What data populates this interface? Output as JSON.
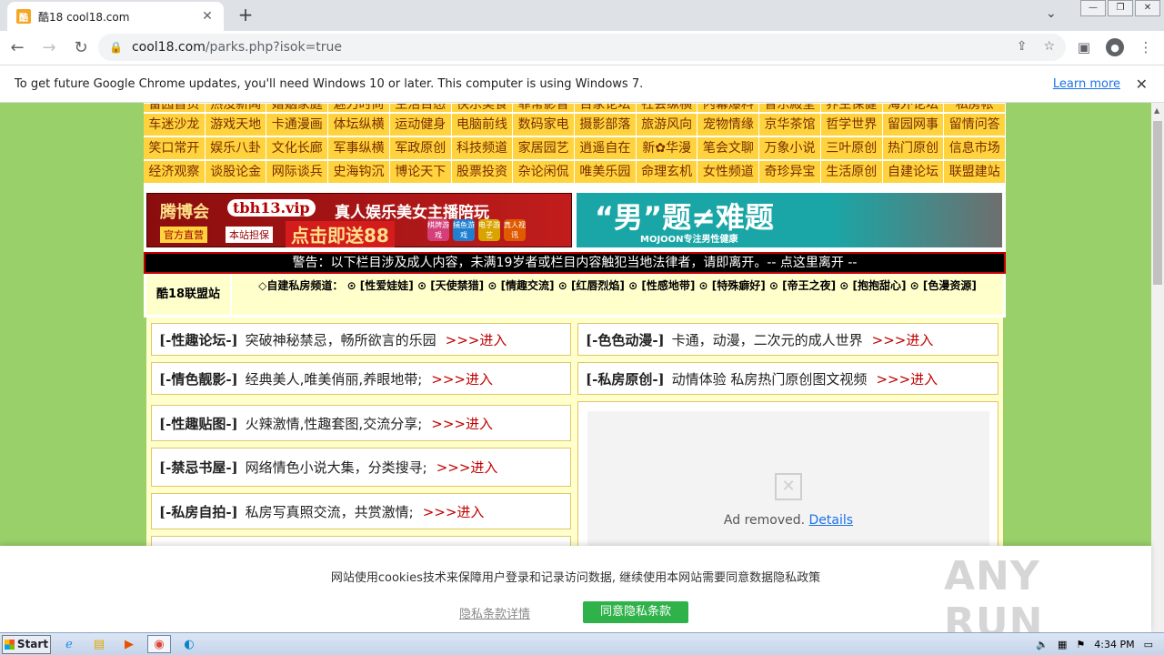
{
  "browser": {
    "tab_title": "酷18 cool18.com",
    "favicon_text": "酷",
    "url_host": "cool18.com",
    "url_path": "/parks.php?isok=true"
  },
  "infobar": {
    "message": "To get future Google Chrome updates, you'll need Windows 10 or later. This computer is using Windows 7.",
    "learn_more": "Learn more"
  },
  "nav": {
    "partial_row": [
      "留园首页",
      "热没新闻",
      "婚姻家庭",
      "魅力时尚",
      "生活百态",
      "快乐美食",
      "菲常影音",
      "百家论坛",
      "社会纵横",
      "内幕爆料",
      "音乐殿堂",
      "养生保健",
      "海外论坛",
      "私房帐"
    ],
    "rows": [
      [
        "车迷沙龙",
        "游戏天地",
        "卡通漫画",
        "体坛纵横",
        "运动健身",
        "电脑前线",
        "数码家电",
        "摄影部落",
        "旅游风向",
        "宠物情缘",
        "京华茶馆",
        "哲学世界",
        "留园网事",
        "留情问答"
      ],
      [
        "笑口常开",
        "娱乐八卦",
        "文化长廊",
        "军事纵横",
        "军政原创",
        "科技频道",
        "家居园艺",
        "逍遥自在",
        "新✿华漫",
        "笔会文聊",
        "万象小说",
        "三叶原创",
        "热门原创",
        "信息市场"
      ],
      [
        "经济观察",
        "谈股论金",
        "网际谈兵",
        "史海钩沉",
        "博论天下",
        "股票投资",
        "杂论闲侃",
        "唯美乐园",
        "命理玄机",
        "女性频道",
        "奇珍异宝",
        "生活原创",
        "自建论坛",
        "联盟建站"
      ]
    ]
  },
  "banner_left": {
    "logo": "腾博会",
    "domain": "tbh13.vip",
    "slogan": "真人娱乐美女主播陪玩",
    "tag1": "官方直营",
    "tag2": "本站担保",
    "promo": "点击即送88",
    "chips": [
      "棋牌游戏",
      "捕鱼游戏",
      "电子游艺",
      "真人视讯"
    ]
  },
  "banner_right": {
    "title": "“男”题≠难题",
    "sub": "MOJOON专注男性健康"
  },
  "warning": "警告：以下栏目涉及成人内容，未满19岁者或栏目内容触犯当地法律者，请即离开。-- 点这里离开 --",
  "sitebar": {
    "name": "酷18联盟站",
    "channels": "◇自建私房频道：  ⊙ [性爱娃娃]   ⊙ [天使禁猎]   ⊙ [情趣交流]   ⊙ [红唇烈焰]   ⊙ [性感地带]   ⊙ [特殊癖好]   ⊙ [帝王之夜]   ⊙ [抱抱甜心]   ⊙ [色漫资源]"
  },
  "items": [
    {
      "tag": "[-性趣论坛-]",
      "desc": "突破神秘禁忌，畅所欲言的乐园",
      "go": ">>>进入"
    },
    {
      "tag": "[-色色动漫-]",
      "desc": "卡通，动漫，二次元的成人世界",
      "go": ">>>进入"
    },
    {
      "tag": "[-情色靓影-]",
      "desc": "经典美人,唯美俏丽,养眼地带;",
      "go": ">>>进入"
    },
    {
      "tag": "[-私房原创-]",
      "desc": "动情体验  私房热门原创图文视频",
      "go": ">>>进入"
    },
    {
      "tag": "[-性趣贴图-]",
      "desc": "火辣激情,性趣套图,交流分享;",
      "go": ">>>进入"
    },
    {
      "tag": "[-禁忌书屋-]",
      "desc": "网络情色小说大集，分类搜寻;",
      "go": ">>>进入"
    },
    {
      "tag": "[-私房自拍-]",
      "desc": "私房写真照交流，共赏激情;",
      "go": ">>>进入"
    }
  ],
  "ad": {
    "removed": "Ad removed.",
    "details": "Details"
  },
  "cookie": {
    "text": "网站使用cookies技术来保障用户登录和记录访问数据, 继续使用本网站需要同意数据隐私政策",
    "details": "隐私条款详情",
    "agree": "同意隐私条款"
  },
  "watermark": "ANY RUN",
  "taskbar": {
    "start": "Start",
    "time": "4:34 PM"
  },
  "colors": {
    "page_bg": "#9ad06a",
    "nav_cell": "#ffd33d",
    "nav_text": "#7a2c00",
    "panel": "#ffffcc",
    "enter": "#c00000",
    "agree_btn": "#2fb24a"
  }
}
